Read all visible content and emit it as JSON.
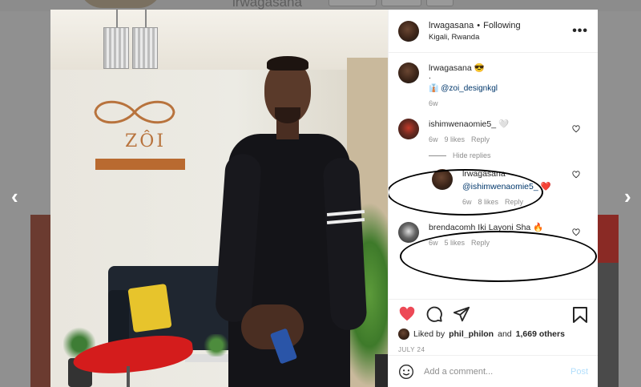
{
  "background": {
    "header_name": "lrwagasana"
  },
  "nav": {
    "prev_glyph": "‹",
    "next_glyph": "›"
  },
  "photo": {
    "sign_text": "ZÔI"
  },
  "post": {
    "author": "lrwagasana",
    "follow_separator": "•",
    "follow_status": "Following",
    "location": "Kigali, Rwanda",
    "more_glyph": "•••"
  },
  "caption": {
    "author": "lrwagasana",
    "emoji": "😎",
    "dot": ".",
    "tag_icon": "👔",
    "mention": "@zoi_designkgl",
    "age": "6w"
  },
  "comments": [
    {
      "user": "ishimwenaomie5_",
      "text_emoji": "🤍",
      "age": "6w",
      "likes": "9 likes",
      "reply_label": "Reply"
    }
  ],
  "hide_replies_label": "Hide replies",
  "reply": {
    "user": "lrwagasana",
    "mention": "@ishimwenaomie5_",
    "emoji": "❤️",
    "age": "6w",
    "likes": "8 likes",
    "reply_label": "Reply"
  },
  "comment2": {
    "user": "brendacomh",
    "text": "Iki Layoni Sha",
    "emoji": "🔥",
    "age": "6w",
    "likes": "5 likes",
    "reply_label": "Reply"
  },
  "likes": {
    "prefix": "Liked by",
    "user": "phil_philon",
    "suffix": "and",
    "others": "1,669 others"
  },
  "date": "JULY 24",
  "add_comment": {
    "placeholder": "Add a comment...",
    "post_label": "Post",
    "emoji_icon": "smiley-icon"
  },
  "colors": {
    "like_red": "#ed4956",
    "link_blue": "#00376b",
    "post_disabled": "#b2dffc",
    "annotation": "#000000"
  }
}
